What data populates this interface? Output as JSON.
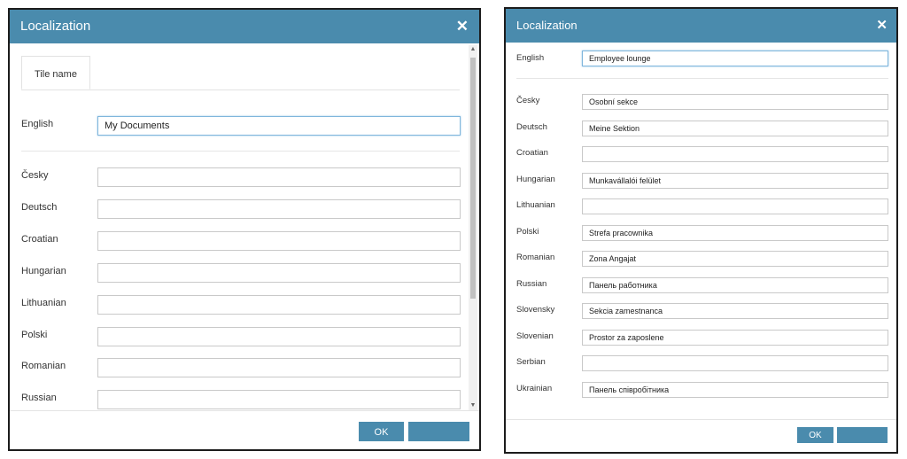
{
  "colors": {
    "accent": "#4a8bad",
    "focus_border": "#7fb6dc"
  },
  "dialog_a": {
    "title": "Localization",
    "close_icon": "close-icon",
    "tab": "Tile name",
    "english_label": "English",
    "english_value": "My Documents",
    "languages": [
      {
        "label": "Česky",
        "value": ""
      },
      {
        "label": "Deutsch",
        "value": ""
      },
      {
        "label": "Croatian",
        "value": ""
      },
      {
        "label": "Hungarian",
        "value": ""
      },
      {
        "label": "Lithuanian",
        "value": ""
      },
      {
        "label": "Polski",
        "value": ""
      },
      {
        "label": "Romanian",
        "value": ""
      },
      {
        "label": "Russian",
        "value": ""
      }
    ],
    "ok_label": "OK",
    "second_button_label": ""
  },
  "dialog_b": {
    "title": "Localization",
    "close_icon": "close-icon",
    "english_label": "English",
    "english_value": "Employee lounge",
    "languages": [
      {
        "label": "Česky",
        "value": "Osobní sekce"
      },
      {
        "label": "Deutsch",
        "value": "Meine Sektion"
      },
      {
        "label": "Croatian",
        "value": ""
      },
      {
        "label": "Hungarian",
        "value": "Munkavállalói felület"
      },
      {
        "label": "Lithuanian",
        "value": ""
      },
      {
        "label": "Polski",
        "value": "Strefa pracownika"
      },
      {
        "label": "Romanian",
        "value": "Zona Angajat"
      },
      {
        "label": "Russian",
        "value": "Панель работника"
      },
      {
        "label": "Slovensky",
        "value": "Sekcia zamestnanca"
      },
      {
        "label": "Slovenian",
        "value": "Prostor za zaposlene"
      },
      {
        "label": "Serbian",
        "value": ""
      },
      {
        "label": "Ukrainian",
        "value": "Панель співробітника"
      }
    ],
    "ok_label": "OK",
    "second_button_label": ""
  }
}
